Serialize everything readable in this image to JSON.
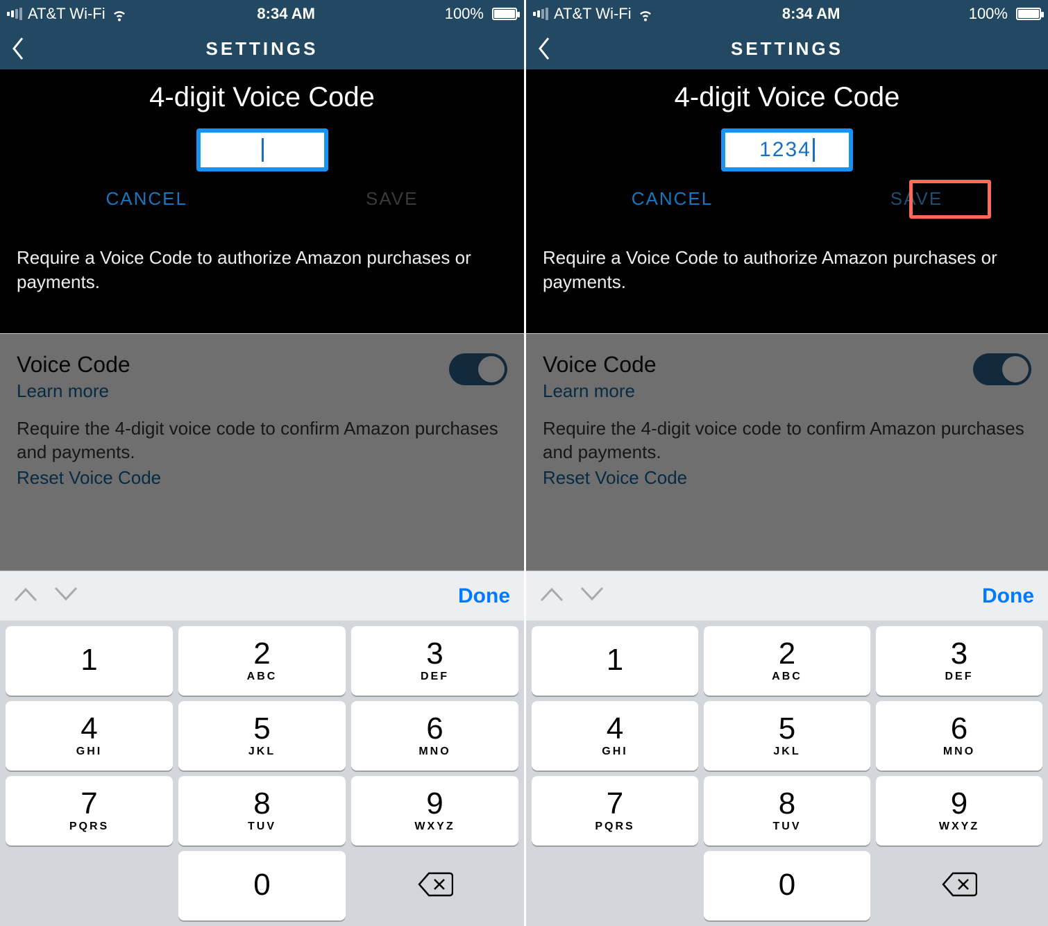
{
  "screens": [
    {
      "status": {
        "carrier": "AT&T Wi-Fi",
        "time": "8:34 AM",
        "battery_pct": "100%"
      },
      "nav": {
        "title": "SETTINGS"
      },
      "voice": {
        "title": "4-digit Voice Code",
        "input_value": "",
        "cancel": "CANCEL",
        "save": "SAVE",
        "save_enabled": false,
        "description": "Require a Voice Code to authorize Amazon purchases or payments.",
        "show_highlight": false
      },
      "settings_panel": {
        "title": "Voice Code",
        "learn_more": "Learn more",
        "description": "Require the 4-digit voice code to confirm Amazon purchases and payments.",
        "reset": "Reset Voice Code",
        "toggle_on": true
      },
      "accessory": {
        "done": "Done"
      }
    },
    {
      "status": {
        "carrier": "AT&T Wi-Fi",
        "time": "8:34 AM",
        "battery_pct": "100%"
      },
      "nav": {
        "title": "SETTINGS"
      },
      "voice": {
        "title": "4-digit Voice Code",
        "input_value": "1234",
        "cancel": "CANCEL",
        "save": "SAVE",
        "save_enabled": true,
        "description": "Require a Voice Code to authorize Amazon purchases or payments.",
        "show_highlight": true
      },
      "settings_panel": {
        "title": "Voice Code",
        "learn_more": "Learn more",
        "description": "Require the 4-digit voice code to confirm Amazon purchases and payments.",
        "reset": "Reset Voice Code",
        "toggle_on": true
      },
      "accessory": {
        "done": "Done"
      }
    }
  ],
  "keypad": [
    [
      {
        "d": "1",
        "l": ""
      },
      {
        "d": "2",
        "l": "ABC"
      },
      {
        "d": "3",
        "l": "DEF"
      }
    ],
    [
      {
        "d": "4",
        "l": "GHI"
      },
      {
        "d": "5",
        "l": "JKL"
      },
      {
        "d": "6",
        "l": "MNO"
      }
    ],
    [
      {
        "d": "7",
        "l": "PQRS"
      },
      {
        "d": "8",
        "l": "TUV"
      },
      {
        "d": "9",
        "l": "WXYZ"
      }
    ],
    [
      {
        "spacer": true
      },
      {
        "d": "0",
        "l": ""
      },
      {
        "back": true
      }
    ]
  ],
  "signal_bars_on": 2,
  "colors": {
    "header": "#234862",
    "accent": "#1893f3",
    "link": "#1577bf",
    "highlight": "#ff6b57"
  }
}
